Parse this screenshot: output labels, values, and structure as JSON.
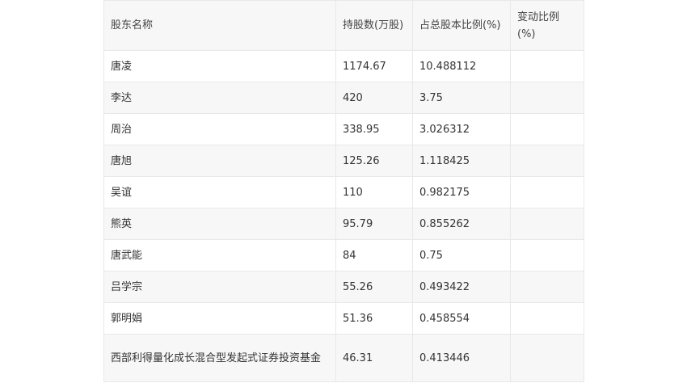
{
  "table": {
    "headers": [
      "股东名称",
      "持股数(万股)",
      "占总股本比例(%)",
      "变动比例(%)"
    ],
    "rows": [
      [
        "唐凌",
        "1174.67",
        "10.488112",
        ""
      ],
      [
        "李达",
        "420",
        "3.75",
        ""
      ],
      [
        "周治",
        "338.95",
        "3.026312",
        ""
      ],
      [
        "唐旭",
        "125.26",
        "1.118425",
        ""
      ],
      [
        "吴谊",
        "110",
        "0.982175",
        ""
      ],
      [
        "熊英",
        "95.79",
        "0.855262",
        ""
      ],
      [
        "唐武能",
        "84",
        "0.75",
        ""
      ],
      [
        "吕学宗",
        "55.26",
        "0.493422",
        ""
      ],
      [
        "郭明娟",
        "51.36",
        "0.458554",
        ""
      ],
      [
        "西部利得量化成长混合型发起式证券投资基金",
        "46.31",
        "0.413446",
        ""
      ]
    ]
  }
}
